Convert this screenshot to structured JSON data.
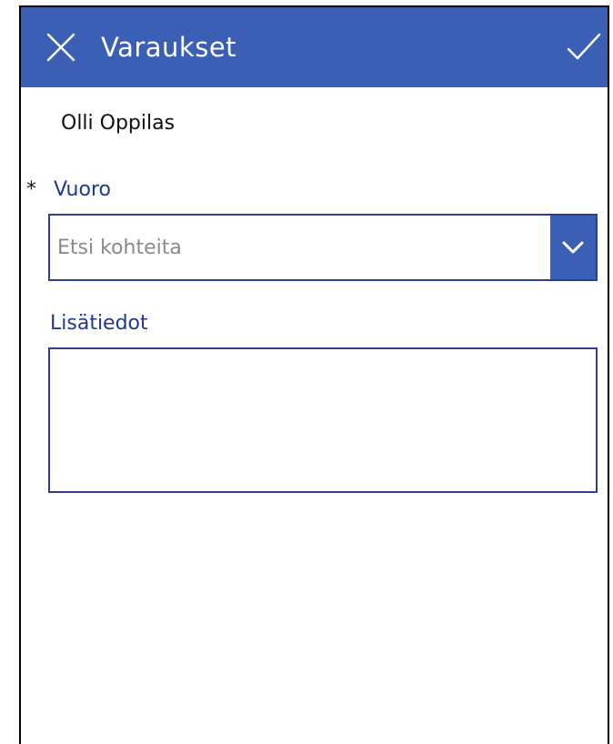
{
  "header": {
    "title": "Varaukset",
    "close_icon": "close-icon",
    "submit_icon": "checkmark-icon",
    "background_color": "#3A5FB4"
  },
  "form": {
    "user_name": "Olli Oppilas",
    "vuoro": {
      "required_marker": "*",
      "label": "Vuoro",
      "placeholder": "Etsi kohteita",
      "value": "",
      "toggle_icon": "chevron-down-icon"
    },
    "lisatiedot": {
      "label": "Lisätiedot",
      "value": ""
    }
  },
  "colors": {
    "accent": "#3A5FB4",
    "label": "#1F3A93",
    "border": "#2A3F8F"
  }
}
